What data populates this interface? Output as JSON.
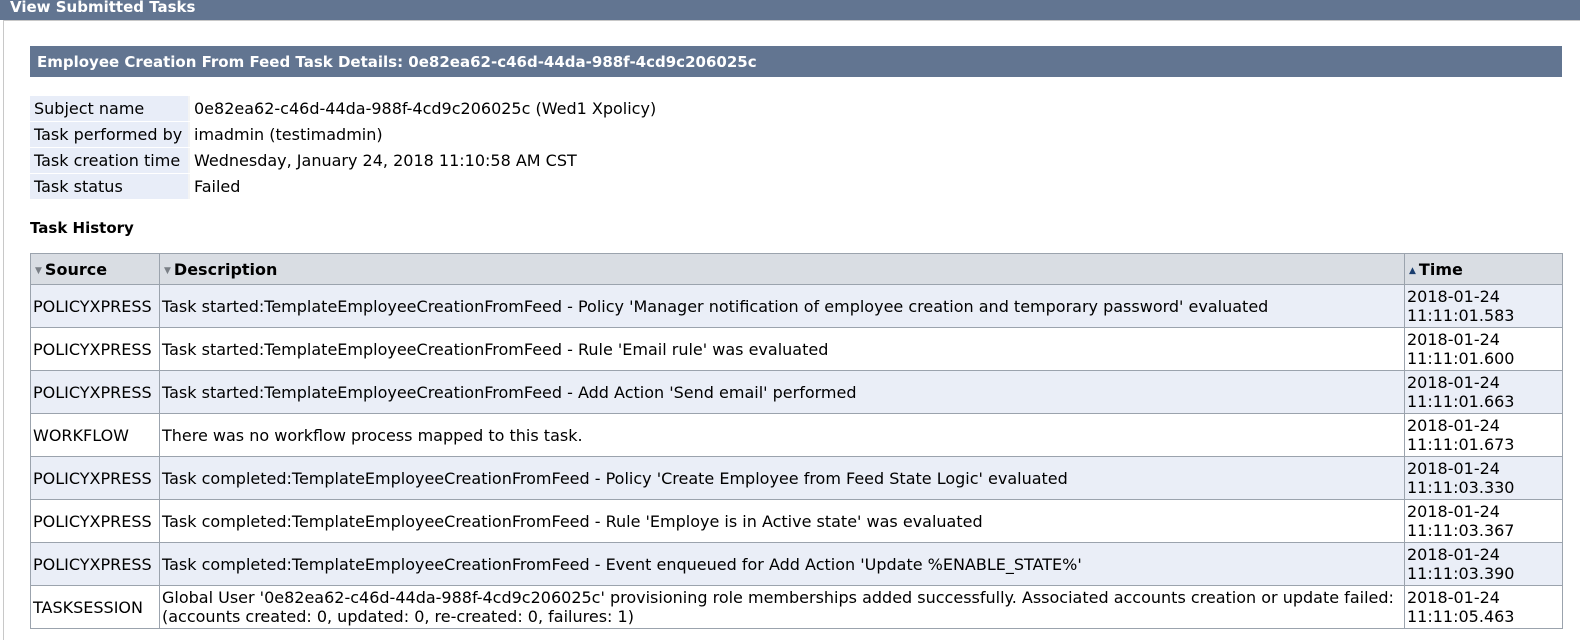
{
  "header": {
    "title": "View Submitted Tasks"
  },
  "section": {
    "title": "Employee Creation From Feed Task Details: 0e82ea62-c46d-44da-988f-4cd9c206025c"
  },
  "details": [
    {
      "label": "Subject name",
      "value": "0e82ea62-c46d-44da-988f-4cd9c206025c (Wed1 Xpolicy)"
    },
    {
      "label": "Task performed by",
      "value": "imadmin (testimadmin)"
    },
    {
      "label": "Task creation time",
      "value": "Wednesday, January 24, 2018 11:10:58 AM CST"
    },
    {
      "label": "Task status",
      "value": "Failed"
    }
  ],
  "history": {
    "title": "Task History",
    "columns": [
      {
        "label": "Source",
        "sort_icon": "sort-down-icon",
        "glyph": "▼"
      },
      {
        "label": "Description",
        "sort_icon": "sort-down-icon",
        "glyph": "▼"
      },
      {
        "label": "Time",
        "sort_icon": "sort-up-icon",
        "glyph": "▲"
      }
    ],
    "rows": [
      {
        "source": "POLICYXPRESS",
        "description": "Task started:TemplateEmployeeCreationFromFeed - Policy 'Manager notification of employee creation and temporary password' evaluated",
        "date": "2018-01-24",
        "clock": "11:11:01.583"
      },
      {
        "source": "POLICYXPRESS",
        "description": "Task started:TemplateEmployeeCreationFromFeed - Rule 'Email rule' was evaluated",
        "date": "2018-01-24",
        "clock": "11:11:01.600"
      },
      {
        "source": "POLICYXPRESS",
        "description": "Task started:TemplateEmployeeCreationFromFeed - Add Action 'Send email' performed",
        "date": "2018-01-24",
        "clock": "11:11:01.663"
      },
      {
        "source": "WORKFLOW",
        "description": "There was no workflow process mapped to this task.",
        "date": "2018-01-24",
        "clock": "11:11:01.673"
      },
      {
        "source": "POLICYXPRESS",
        "description": "Task completed:TemplateEmployeeCreationFromFeed - Policy 'Create Employee from Feed State Logic' evaluated",
        "date": "2018-01-24",
        "clock": "11:11:03.330"
      },
      {
        "source": "POLICYXPRESS",
        "description": "Task completed:TemplateEmployeeCreationFromFeed - Rule 'Employe is in Active state' was evaluated",
        "date": "2018-01-24",
        "clock": "11:11:03.367"
      },
      {
        "source": "POLICYXPRESS",
        "description": "Task completed:TemplateEmployeeCreationFromFeed - Event enqueued for Add Action 'Update %ENABLE_STATE%'",
        "date": "2018-01-24",
        "clock": "11:11:03.390"
      },
      {
        "source": "TASKSESSION",
        "description": "Global User '0e82ea62-c46d-44da-988f-4cd9c206025c' provisioning role memberships added successfully. Associated accounts creation or update failed: (accounts created: 0, updated: 0, re-created: 0, failures: 1)",
        "date": "2018-01-24",
        "clock": "11:11:05.463"
      }
    ]
  }
}
